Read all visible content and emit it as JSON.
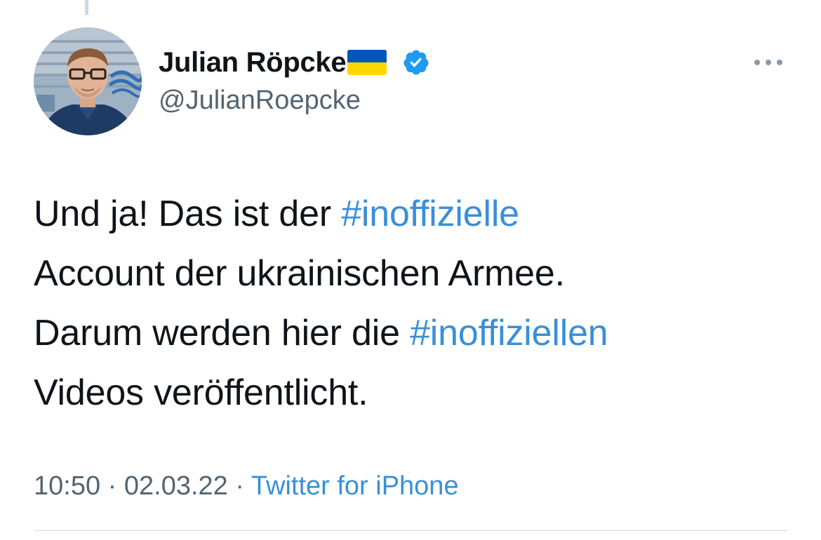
{
  "tweet": {
    "author": {
      "display_name": "Julian Röpcke",
      "handle": "@JulianRoepcke",
      "flag_icon": "ukraine-flag-icon",
      "verified_icon": "verified-badge-icon",
      "avatar_icon": "profile-photo"
    },
    "more_icon": "more-options-icon",
    "text_lines": [
      [
        {
          "text": "Und ja! Das ist der ",
          "type": "text"
        },
        {
          "text": "#inoffizielle",
          "type": "hashtag"
        }
      ],
      [
        {
          "text": "Account der ukrainischen Armee.",
          "type": "text"
        }
      ],
      [
        {
          "text": "Darum werden hier die ",
          "type": "text"
        },
        {
          "text": "#inoffiziellen",
          "type": "hashtag"
        }
      ],
      [
        {
          "text": "Videos veröffentlicht.",
          "type": "text"
        }
      ]
    ],
    "time": "10:50",
    "date": "02.03.22",
    "separator": "·",
    "source": "Twitter for iPhone"
  },
  "colors": {
    "text": "#0f1419",
    "secondary": "#536471",
    "link": "#3a8fd8",
    "verified": "#1d9bf0",
    "flag_blue": "#0057b7",
    "flag_yellow": "#ffd700",
    "divider": "#cfd9de"
  }
}
